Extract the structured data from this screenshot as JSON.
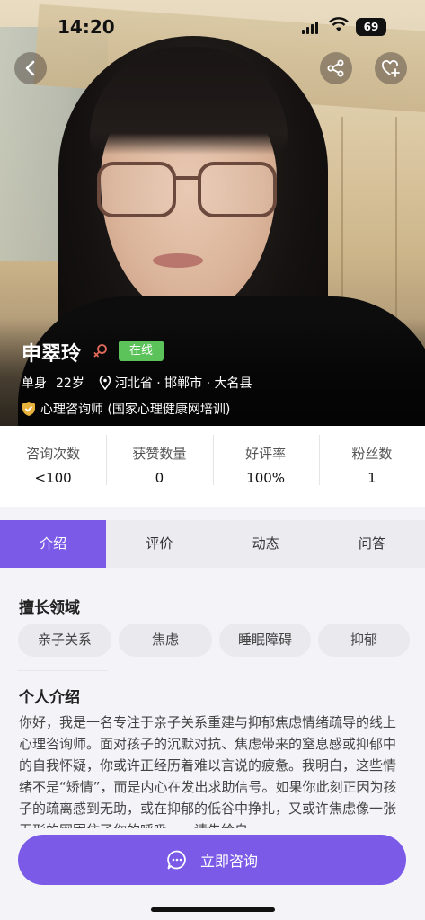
{
  "status_bar": {
    "time": "14:20",
    "battery": "69"
  },
  "profile": {
    "name": "申翠玲",
    "online_status": "在线",
    "marital_status": "单身",
    "age": "22岁",
    "location": "河北省 · 邯郸市 · 大名县",
    "certification": "心理咨询师 (国家心理健康网培训)"
  },
  "stats": [
    {
      "label": "咨询次数",
      "value": "<100"
    },
    {
      "label": "获赞数量",
      "value": "0"
    },
    {
      "label": "好评率",
      "value": "100%"
    },
    {
      "label": "粉丝数",
      "value": "1"
    }
  ],
  "tabs": [
    "介绍",
    "评价",
    "动态",
    "问答"
  ],
  "expertise": {
    "title": "擅长领域",
    "items": [
      "亲子关系",
      "焦虑",
      "睡眠障碍",
      "抑郁"
    ]
  },
  "intro": {
    "title": "个人介绍",
    "text": "你好，我是一名专注于亲子关系重建与抑郁焦虑情绪疏导的线上心理咨询师。面对孩子的沉默对抗、焦虑带来的窒息感或抑郁中的自我怀疑，你或许正经历着难以言说的疲惫。我明白，这些情绪不是“矫情”，而是内心在发出求助信号。如果你此刻正因为孩子的疏离感到无助，或在抑郁的低谷中挣扎，又或许焦虑像一张无形的网困住了你的呼吸——请先给自"
  },
  "cta": {
    "label": "立即咨询"
  },
  "colors": {
    "accent": "#7b5ae8",
    "online": "#5cc25a"
  }
}
